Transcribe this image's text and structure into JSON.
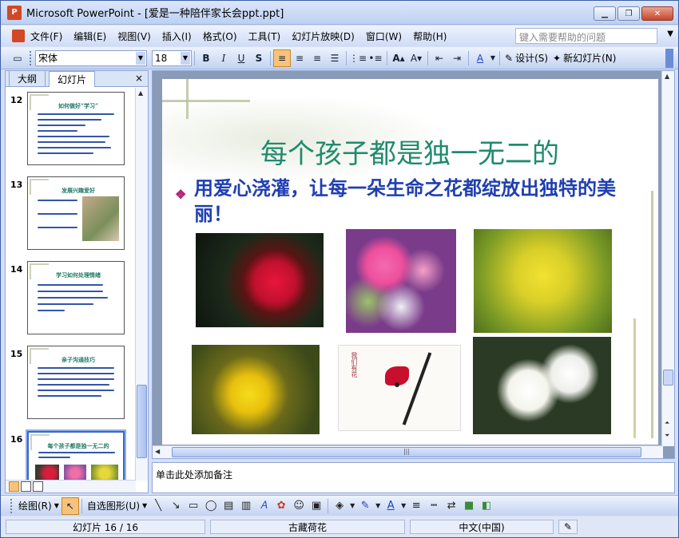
{
  "window": {
    "app_name": "Microsoft PowerPoint",
    "doc_title": "[爱是一种陪伴家长会ppt.ppt]",
    "min_label": "▁",
    "max_label": "❐",
    "close_label": "✕"
  },
  "menu": {
    "items": [
      "文件(F)",
      "编辑(E)",
      "视图(V)",
      "插入(I)",
      "格式(O)",
      "工具(T)",
      "幻灯片放映(D)",
      "窗口(W)",
      "帮助(H)"
    ],
    "help_placeholder": "键入需要帮助的问题"
  },
  "toolbar": {
    "font": "宋体",
    "size": "18",
    "bold": "B",
    "italic": "I",
    "underline": "U",
    "shadow": "S",
    "design_label": "设计(S)",
    "new_slide_label": "新幻灯片(N)"
  },
  "pane": {
    "tab_outline": "大纲",
    "tab_slides": "幻灯片",
    "close": "×"
  },
  "thumbnails": [
    {
      "num": "12",
      "title": "如何做好“学习”"
    },
    {
      "num": "13",
      "title": "发展兴趣爱好"
    },
    {
      "num": "14",
      "title": "学习如何处理情绪"
    },
    {
      "num": "15",
      "title": "亲子沟通技巧"
    },
    {
      "num": "16",
      "title": "每个孩子都是独一无二的"
    }
  ],
  "slide": {
    "title": "每个孩子都是独一无二的",
    "bullet": "用爱心浇灌，让每一朵生命之花都绽放出独特的美丽！",
    "stamp_text": "我们有花"
  },
  "notes": {
    "placeholder": "单击此处添加备注"
  },
  "drawbar": {
    "draw_label": "绘图(R)",
    "autoshape_label": "自选图形(U)"
  },
  "status": {
    "slide_info": "幻灯片 16 / 16",
    "design": "古藏荷花",
    "language": "中文(中国)"
  }
}
